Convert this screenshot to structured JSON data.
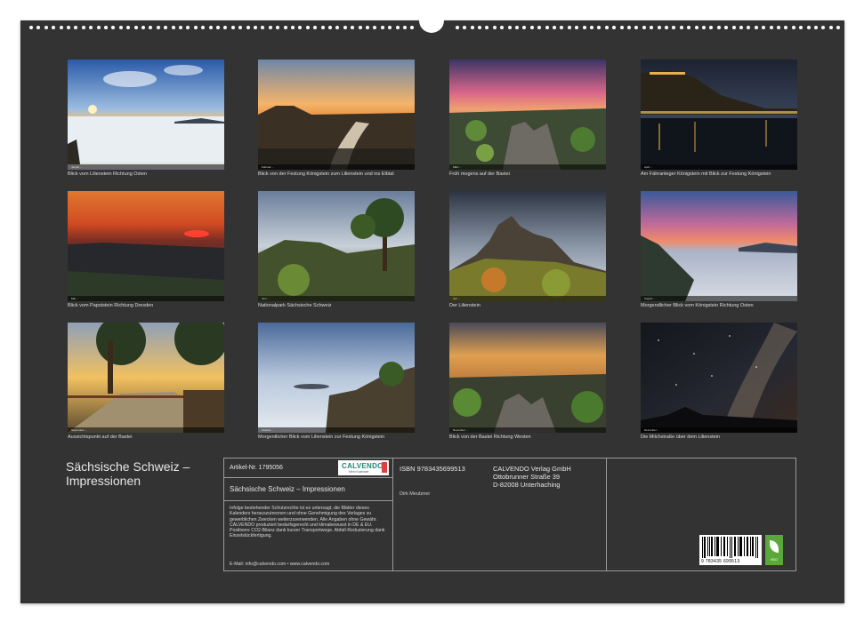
{
  "calendar": {
    "title_line1": "Sächsische Schweiz –",
    "title_line2": "Impressionen"
  },
  "photos": [
    {
      "caption": "Blick vom Lilienstein Richtung Osten",
      "month_label": "Januar ..."
    },
    {
      "caption": "Blick von der Festung Königstein zum Lilienstein und ins Elbtal",
      "month_label": "Februar ..."
    },
    {
      "caption": "Früh mogens auf der Bastei",
      "month_label": "März ..."
    },
    {
      "caption": "Am Fähranleger Königstein mit Blick zur Festung Königstein",
      "month_label": "April ..."
    },
    {
      "caption": "Blick vom Papststein Richtung Dresden",
      "month_label": "Mai ..."
    },
    {
      "caption": "Nationalpark Sächsische Schweiz",
      "month_label": "Juni ..."
    },
    {
      "caption": "Der Lilienstein",
      "month_label": "Juli ..."
    },
    {
      "caption": "Morgendlicher Blick vom Königstein Richtung Osten",
      "month_label": "August ..."
    },
    {
      "caption": "Aussichtspunkt auf der Bastei",
      "month_label": "September ..."
    },
    {
      "caption": "Morgentlicher Blick vom Lilienstein zur Festung Königstein",
      "month_label": "Oktober ..."
    },
    {
      "caption": "Blick von der Bastei Richtung Westen",
      "month_label": "November ..."
    },
    {
      "caption": "Die Milchstraße über dem Lilienstein",
      "month_label": "Dezember ..."
    }
  ],
  "info": {
    "article_no": "Artikel-Nr. 1795056",
    "calvendo_logo": "CALVENDO",
    "calvendo_tagline": "Mein Kalender",
    "subtitle": "Sächsische Schweiz – Impressionen",
    "legal_text": "Infolge bestehender Schutzrechte ist es untersagt, die Blätter dieses Kalenders herauszutrennen und ohne Genehmigung des Verlages zu gewerblichen Zwecken weiterzuverwenden. Alle Angaben ohne Gewähr. CALVENDO produziert bedarfsgerecht und klimabewusst in DE & EU. Positivere CO2-Bilanz dank kurzer Transportwege. Abfall-Reduzierung dank Einzelstückfertigung.",
    "contact": "E-Mail: info@calvendo.com • www.calvendo.com",
    "isbn": "ISBN 9783435699513",
    "publisher_name": "CALVENDO Verlag GmbH",
    "publisher_street": "Ottobrunner Straße 39",
    "publisher_city": "D-82008 Unterhaching",
    "author": "Dirk Meutzner",
    "barcode_number": "9 783435 699513",
    "eco_label": "eco"
  }
}
